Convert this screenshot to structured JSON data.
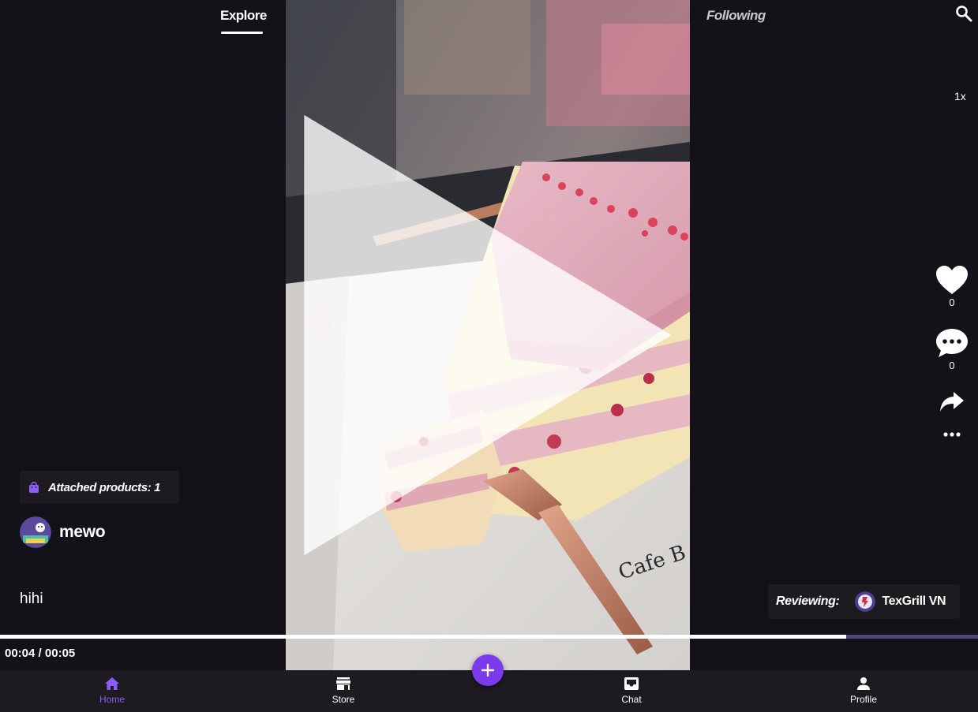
{
  "top_nav": {
    "explore_label": "Explore",
    "following_label": "Following"
  },
  "player": {
    "speed_label": "1x",
    "current_time": "00:04",
    "duration": "00:05",
    "time_separator": " / ",
    "progress": 0.865
  },
  "actions": {
    "like_count": "0",
    "comment_count": "0"
  },
  "post": {
    "attached_label": "Attached products: 1",
    "author_name": "mewo",
    "caption": "hihi"
  },
  "reviewing": {
    "label": "Reviewing:",
    "shop_name": "TexGrill VN"
  },
  "bottom_nav": {
    "items": [
      {
        "label": "Home",
        "icon": "home-icon",
        "active": true
      },
      {
        "label": "Store",
        "icon": "store-icon"
      },
      {
        "label": "Chat",
        "icon": "inbox-icon"
      },
      {
        "label": "Profile",
        "icon": "person-icon"
      }
    ]
  },
  "colors": {
    "background": "#141218",
    "accent": "#7c3aed",
    "active_nav": "#8b5cf6",
    "progress_remaining": "#4a4a7a"
  }
}
